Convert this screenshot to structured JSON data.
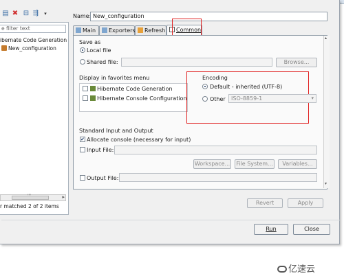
{
  "left": {
    "filter_placeholder": "e filter text",
    "tree_items": [
      "ibernate Code Generation",
      "New_configuration"
    ],
    "matched": "r matched 2 of 2 items",
    "scroll_marker": "'''"
  },
  "name": {
    "label": "Name:",
    "value": "New_configuration"
  },
  "tabs": [
    "Main",
    "Exporters",
    "Refresh",
    "Common"
  ],
  "save_as": {
    "title": "Save as",
    "local": "Local file",
    "shared": "Shared file:",
    "browse": "Browse..."
  },
  "favorites": {
    "title": "Display in favorites menu",
    "items": [
      "Hibernate Code Generation",
      "Hibernate Console Configuration"
    ]
  },
  "encoding": {
    "title": "Encoding",
    "default": "Default - inherited (UTF-8)",
    "other": "Other",
    "other_value": "ISO-8859-1"
  },
  "std_io": {
    "title": "Standard Input and Output",
    "allocate": "Allocate console (necessary for input)",
    "input_file": "Input File:",
    "workspace": "Workspace...",
    "file_system": "File System...",
    "variables": "Variables...",
    "output_file": "Output File:"
  },
  "actions": {
    "revert": "Revert",
    "apply": "Apply",
    "run": "Run",
    "close": "Close"
  },
  "brand": "亿速云",
  "colors": {
    "highlight_red": "#e02020",
    "accent": "#1f3b66"
  }
}
